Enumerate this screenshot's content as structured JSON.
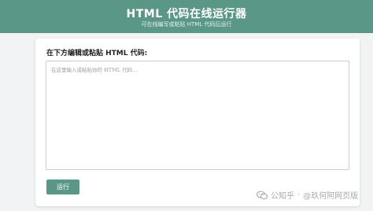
{
  "header": {
    "title": "HTML 代码在线运行器",
    "subtitle": "可在线编写或粘贴 HTML 代码后运行"
  },
  "editor": {
    "label": "在下方编辑或粘贴 HTML 代码:",
    "placeholder": "在这里输入或粘贴你的 HTML 代码...",
    "value": ""
  },
  "run_button": {
    "label": "运行"
  },
  "watermark": {
    "icon": "wechat-icon",
    "platform": "公知乎",
    "separator": "·",
    "author": "@玖何阿网页版"
  },
  "colors": {
    "accent": "#5a9786",
    "background": "#f1f3f4"
  }
}
